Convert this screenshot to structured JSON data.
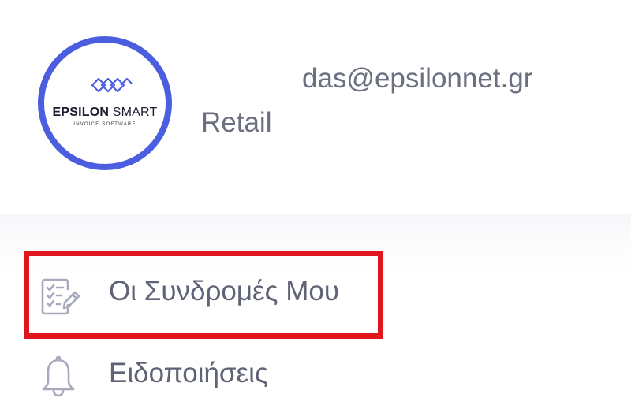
{
  "profile": {
    "logo": {
      "brand_bold": "EPSILON",
      "brand_light": "SMART",
      "tagline": "INVOICE SOFTWARE"
    },
    "email": "das@epsilonnet.gr",
    "role": "Retail"
  },
  "menu": {
    "items": [
      {
        "label": "Οι Συνδρομές Μου",
        "icon": "subscriptions-checklist-icon",
        "highlighted": true
      },
      {
        "label": "Ειδοποιήσεις",
        "icon": "bell-icon",
        "highlighted": false
      }
    ]
  },
  "colors": {
    "avatar_ring": "#4b5ee0",
    "highlight_border": "#e0161e",
    "text": "#6b6f80",
    "icon": "#a7aabb"
  }
}
